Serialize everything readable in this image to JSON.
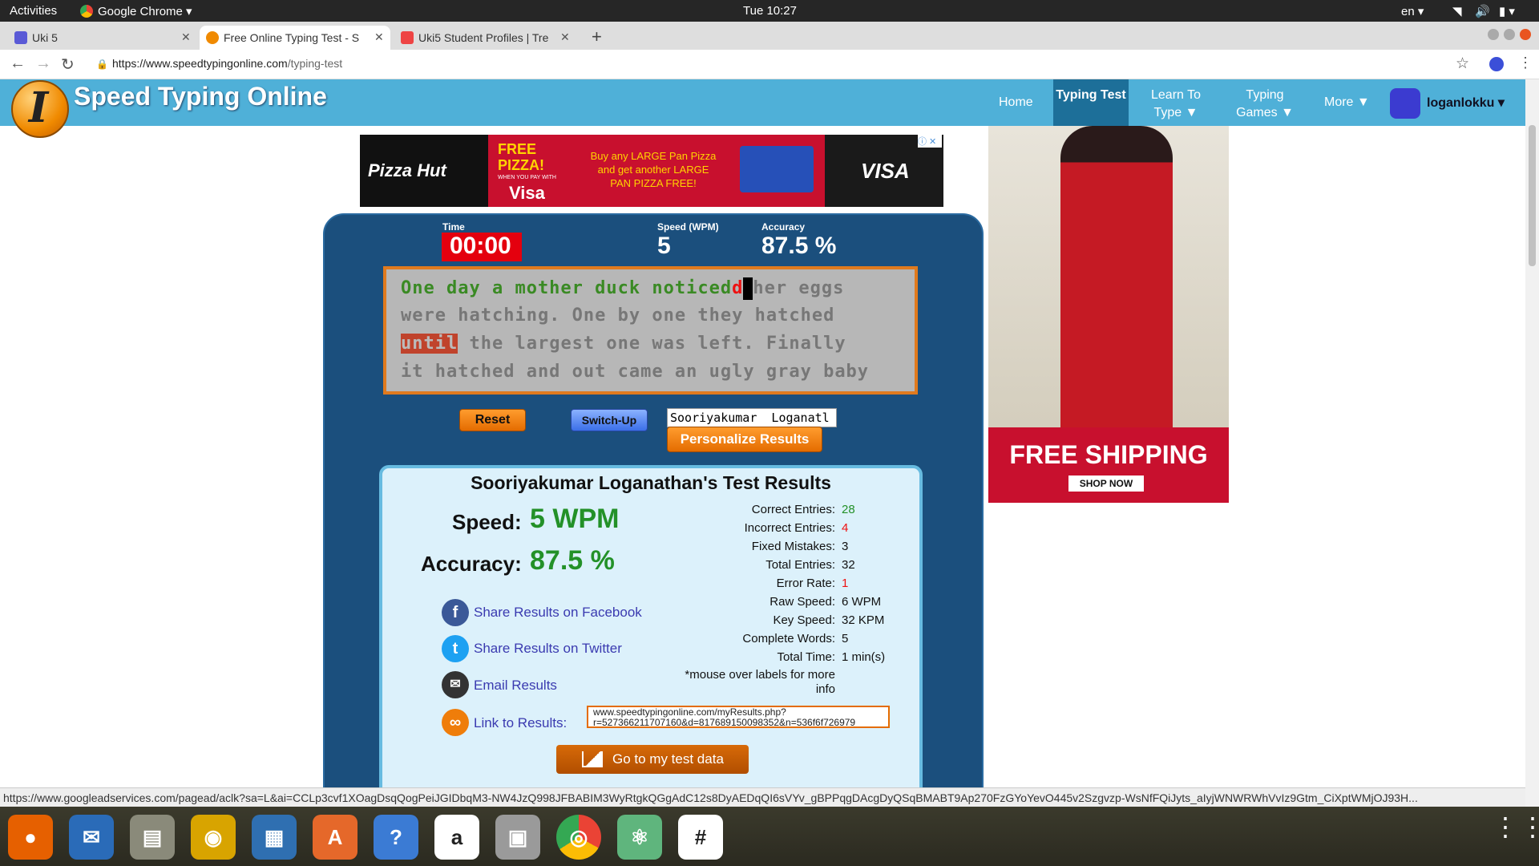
{
  "system": {
    "activities": "Activities",
    "app_name": "Google Chrome",
    "clock": "Tue 10:27",
    "lang": "en"
  },
  "tabs": [
    {
      "title": "Uki 5",
      "active": false
    },
    {
      "title": "Free Online Typing Test - S",
      "active": true
    },
    {
      "title": "Uki5 Student Profiles | Tre",
      "active": false
    }
  ],
  "address": {
    "domain": "https://www.speedtypingonline.com",
    "path": "/typing-test"
  },
  "site": {
    "logo_letter": "I",
    "title": "Speed Typing Online",
    "nav": [
      {
        "label": "Home"
      },
      {
        "label": "Typing Test",
        "active": true
      },
      {
        "label": "Learn To Type ▼"
      },
      {
        "label": "Typing Games ▼"
      },
      {
        "label": "More ▼"
      }
    ],
    "user": "loganlokku ▾"
  },
  "ads": {
    "top": {
      "brand": "Pizza Hut",
      "headline": "FREE PIZZA!",
      "subline": "WHEN YOU PAY WITH",
      "pay_brand": "Visa",
      "offer": "Buy any LARGE Pan Pizza and get another LARGE PAN PIZZA FREE!",
      "visa": "VISA"
    },
    "right": {
      "headline": "FREE SHIPPING",
      "cta": "SHOP NOW"
    }
  },
  "stats": {
    "time_label": "Time",
    "time_value": "00:00",
    "speed_label": "Speed (WPM)",
    "speed_value": "5",
    "accuracy_label": "Accuracy",
    "accuracy_value": "87.5 %"
  },
  "passage": {
    "line1_typed": "One day a mother duck noticed",
    "line1_wrong": "d",
    "line1_rest": "her eggs",
    "line2": "were hatching. One by one they hatched",
    "line3_current": "until",
    "line3_rest": " the largest one was left. Finally",
    "line4": "it hatched and out came an ugly gray baby"
  },
  "controls": {
    "reset": "Reset",
    "switch_up": "Switch-Up",
    "name_value": "Sooriyakumar  Loganatl",
    "personalize": "Personalize Results"
  },
  "results": {
    "title": "Sooriyakumar Loganathan's Test Results",
    "speed_label": "Speed:",
    "speed_value": "5 WPM",
    "accuracy_label": "Accuracy:",
    "accuracy_value": "87.5 %",
    "share_facebook": "Share Results on Facebook",
    "share_twitter": "Share Results on Twitter",
    "email": "Email Results",
    "link_label": "Link to Results:",
    "link_url": "www.speedtypingonline.com/myResults.php?r=527366211707160&d=817689150098352&n=536f6f726979",
    "details": [
      {
        "label": "Correct Entries:",
        "value": "28",
        "color": "#239128"
      },
      {
        "label": "Incorrect Entries:",
        "value": "4",
        "color": "#e11"
      },
      {
        "label": "Fixed Mistakes:",
        "value": "3",
        "color": "#111"
      },
      {
        "label": "Total Entries:",
        "value": "32",
        "color": "#111"
      },
      {
        "label": "Error Rate:",
        "value": "1",
        "color": "#e11"
      },
      {
        "label": "Raw Speed:",
        "value": "6 WPM",
        "color": "#111"
      },
      {
        "label": "Key Speed:",
        "value": "32 KPM",
        "color": "#111"
      },
      {
        "label": "Complete Words:",
        "value": "5",
        "color": "#111"
      },
      {
        "label": "Total Time:",
        "value": "1 min(s)",
        "color": "#111"
      }
    ],
    "note": "*mouse over labels for more info",
    "data_button": "Go to my test data"
  },
  "statusbar": "https://www.googleadservices.com/pagead/aclk?sa=L&ai=CCLp3cvf1XOagDsqQogPeiJGIDbqM3-NW4JzQ998JFBABIM3WyRtgkQGgAdC12s8DyAEDqQI6sVYv_gBPPqgDAcgDyQSqBMABT9Ap270FzGYoYevO445v2Szgvzp-WsNfFQiJyts_aIyjWNWRWhVvIz9Gtm_CiXptWMjOJ93H...",
  "dock": [
    {
      "icon": "firefox-icon",
      "color": "#e66000"
    },
    {
      "icon": "thunderbird-icon",
      "color": "#2a6bb8"
    },
    {
      "icon": "files-icon",
      "color": "#8a8a7a"
    },
    {
      "icon": "rhythmbox-icon",
      "color": "#d8a400"
    },
    {
      "icon": "writer-icon",
      "color": "#2f6fb1"
    },
    {
      "icon": "software-icon",
      "color": "#e5682a"
    },
    {
      "icon": "help-icon",
      "color": "#3b7bd4"
    },
    {
      "icon": "amazon-icon",
      "color": "#ffffff"
    },
    {
      "icon": "camera-icon",
      "color": "#9a9a9a"
    },
    {
      "icon": "chrome-icon",
      "color": "#4285f4"
    },
    {
      "icon": "atom-icon",
      "color": "#5fb57d"
    },
    {
      "icon": "slack-icon",
      "color": "#ffffff"
    }
  ]
}
